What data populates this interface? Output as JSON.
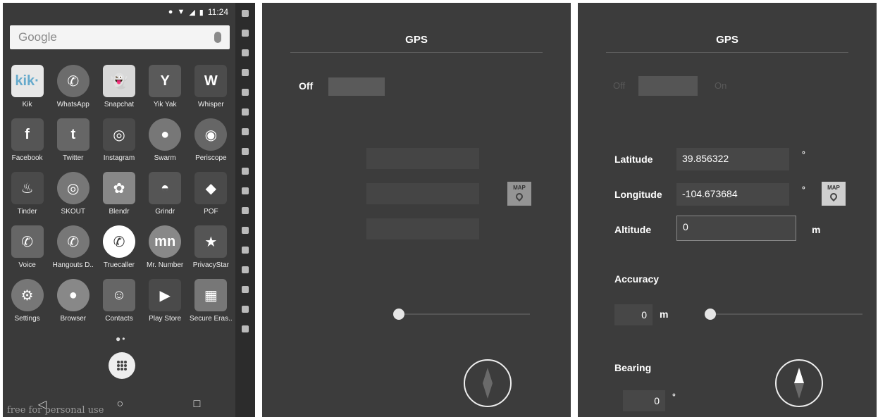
{
  "phone": {
    "status": {
      "time": "11:24"
    },
    "search": {
      "label": "Google"
    },
    "apps": [
      [
        {
          "label": "Kik",
          "text": "kik·",
          "color": "#e8e8e8",
          "fg": "#6ac"
        },
        {
          "label": "WhatsApp",
          "text": "✆",
          "color": "#6c6c6c",
          "round": true
        },
        {
          "label": "Snapchat",
          "text": "👻",
          "color": "#d8d8d8",
          "fg": "#444"
        },
        {
          "label": "Yik Yak",
          "text": "Y",
          "color": "#5a5a5a"
        },
        {
          "label": "Whisper",
          "text": "W",
          "color": "#4c4c4c"
        }
      ],
      [
        {
          "label": "Facebook",
          "text": "f",
          "color": "#555"
        },
        {
          "label": "Twitter",
          "text": "t",
          "color": "#666"
        },
        {
          "label": "Instagram",
          "text": "◎",
          "color": "#4a4a4a"
        },
        {
          "label": "Swarm",
          "text": "●",
          "color": "#777",
          "round": true
        },
        {
          "label": "Periscope",
          "text": "◉",
          "color": "#666",
          "round": true
        }
      ],
      [
        {
          "label": "Tinder",
          "text": "♨",
          "color": "#4a4a4a"
        },
        {
          "label": "SKOUT",
          "text": "◎",
          "color": "#777",
          "round": true
        },
        {
          "label": "Blendr",
          "text": "✿",
          "color": "#888"
        },
        {
          "label": "Grindr",
          "text": "◓",
          "color": "#555"
        },
        {
          "label": "POF",
          "text": "◆",
          "color": "#4a4a4a"
        }
      ],
      [
        {
          "label": "Voice",
          "text": "✆",
          "color": "#666"
        },
        {
          "label": "Hangouts D..",
          "text": "✆",
          "color": "#777",
          "round": true
        },
        {
          "label": "Truecaller",
          "text": "✆",
          "color": "#fff",
          "fg": "#333",
          "round": true
        },
        {
          "label": "Mr. Number",
          "text": "mn",
          "color": "#888",
          "round": true
        },
        {
          "label": "PrivacyStar",
          "text": "★",
          "color": "#555"
        }
      ],
      [
        {
          "label": "Settings",
          "text": "⚙",
          "color": "#777",
          "round": true
        },
        {
          "label": "Browser",
          "text": "●",
          "color": "#888",
          "round": true
        },
        {
          "label": "Contacts",
          "text": "☺",
          "color": "#666"
        },
        {
          "label": "Play Store",
          "text": "▶",
          "color": "#4a4a4a"
        },
        {
          "label": "Secure Eras..",
          "text": "▦",
          "color": "#777"
        }
      ]
    ],
    "nav": {
      "back": "◁",
      "home": "○",
      "recents": "□"
    },
    "watermark": "free for personal use"
  },
  "gps_left": {
    "title": "GPS",
    "toggle_label": "Off"
  },
  "gps_right": {
    "title": "GPS",
    "toggle_off": "Off",
    "toggle_on": "On",
    "latitude_label": "Latitude",
    "latitude_value": "39.856322",
    "latitude_unit": "°",
    "longitude_label": "Longitude",
    "longitude_value": "-104.673684",
    "longitude_unit": "°",
    "altitude_label": "Altitude",
    "altitude_value": "0",
    "altitude_unit": "m",
    "accuracy_label": "Accuracy",
    "accuracy_value": "0",
    "accuracy_unit": "m",
    "bearing_label": "Bearing",
    "bearing_value": "0",
    "bearing_unit": "°",
    "map_label": "MAP"
  }
}
